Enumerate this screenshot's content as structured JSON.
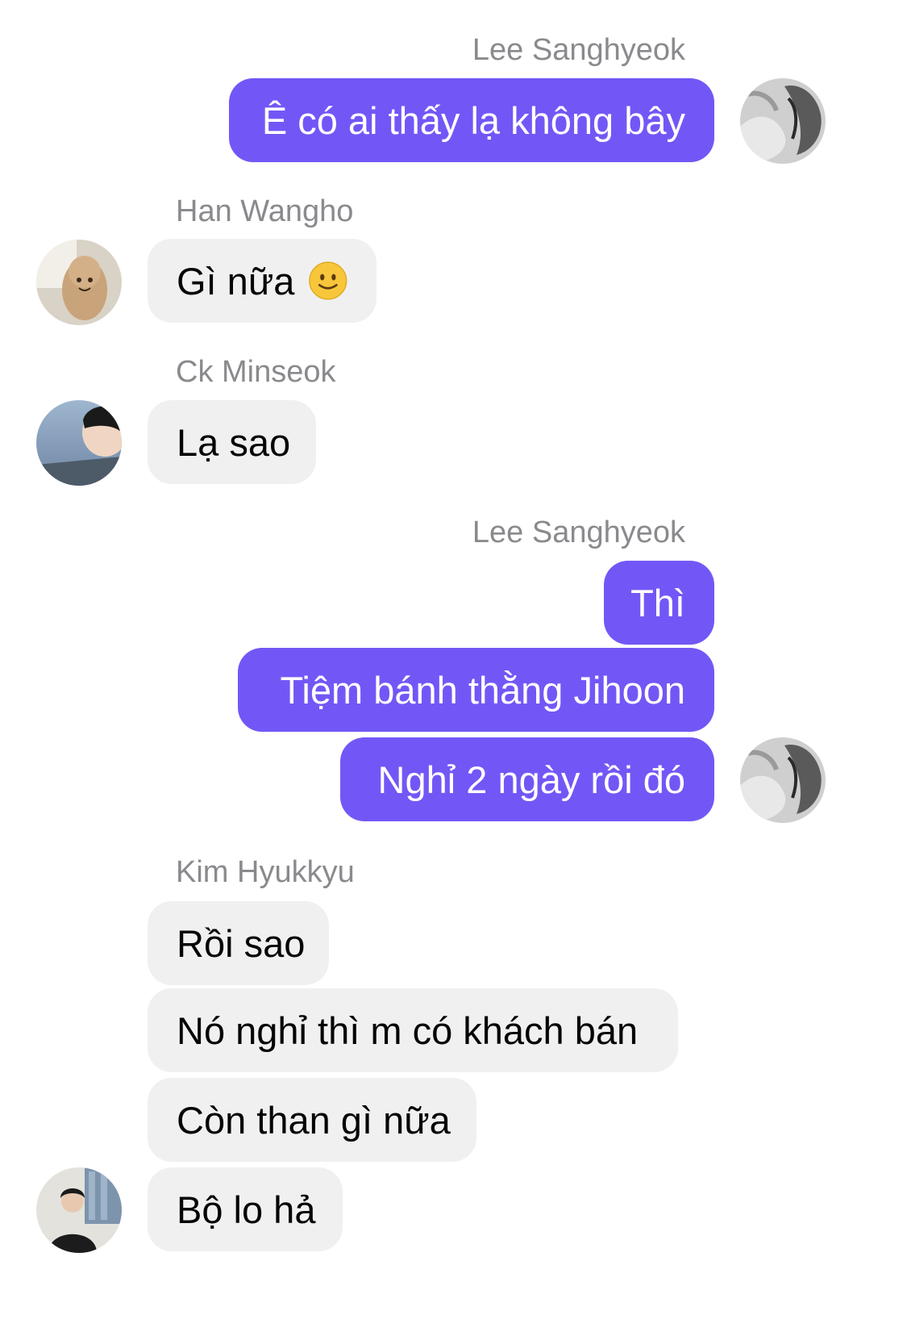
{
  "messages": [
    {
      "sender": "Lee Sanghyeok",
      "text": "Ê có ai thấy lạ không bây"
    },
    {
      "sender": "Han Wangho",
      "text": "Gì nữa",
      "emoji": "slightly-smiling-face"
    },
    {
      "sender": "Ck Minseok",
      "text": "Lạ sao"
    },
    {
      "sender": "Lee Sanghyeok",
      "lines": [
        "Thì",
        "Tiệm bánh thằng Jihoon",
        "Nghỉ 2 ngày rồi đó"
      ]
    },
    {
      "sender": "Kim Hyukkyu",
      "lines": [
        "Rồi sao",
        "Nó nghỉ thì m có khách bán",
        "Còn than gì nữa",
        "Bộ lo hả"
      ]
    }
  ],
  "colors": {
    "outgoing_bubble": "#7357f6",
    "incoming_bubble": "#f0f0f0",
    "sender_name": "#8a8a8e"
  }
}
